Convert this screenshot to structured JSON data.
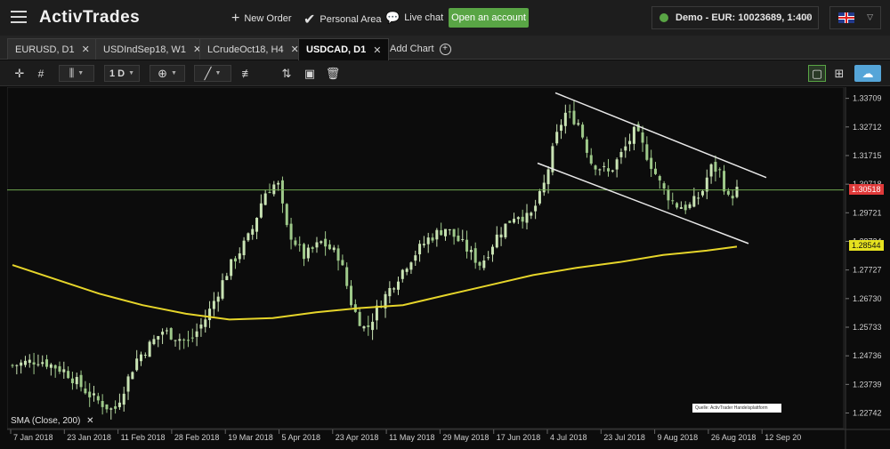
{
  "header": {
    "logo": "ActivTrades",
    "new_order": "New Order",
    "personal_area": "Personal Area",
    "live_chat": "Live chat",
    "open_account": "Open an account",
    "account": "Demo - EUR: 10023689, 1:400"
  },
  "tabs": [
    {
      "label": "EURUSD, D1",
      "active": false
    },
    {
      "label": "USDIndSep18, W1",
      "active": false
    },
    {
      "label": "LCrudeOct18, H4",
      "active": false
    },
    {
      "label": "USDCAD, D1",
      "active": true
    }
  ],
  "add_chart": "Add Chart",
  "toolbar": {
    "period": "1 D"
  },
  "indicator": {
    "label": "SMA  (Close, 200)"
  },
  "source": "Quelle: ActivTrader Handelsplattform",
  "chart_data": {
    "type": "candlestick",
    "symbol": "USDCAD",
    "timeframe": "D1",
    "y_ticks": [
      1.33709,
      1.32712,
      1.31715,
      1.30718,
      1.29721,
      1.28724,
      1.27727,
      1.2673,
      1.25733,
      1.24736,
      1.23739,
      1.22742
    ],
    "x_ticks": [
      "7 Jan 2018",
      "23 Jan 2018",
      "11 Feb 2018",
      "28 Feb 2018",
      "19 Mar 2018",
      "5 Apr 2018",
      "23 Apr 2018",
      "11 May 2018",
      "29 May 2018",
      "17 Jun 2018",
      "4 Jul 2018",
      "23 Jul 2018",
      "9 Aug 2018",
      "26 Aug 2018",
      "12 Sep 20"
    ],
    "current_price": 1.30518,
    "sma_value": 1.28544,
    "ylim": [
      1.222,
      1.341
    ],
    "colors": {
      "candle_up": "#c9e3b4",
      "candle_down": "#9ec98a",
      "sma": "#e6d52a",
      "price_line": "#6fa64f",
      "channel": "#e8e8e8"
    }
  }
}
